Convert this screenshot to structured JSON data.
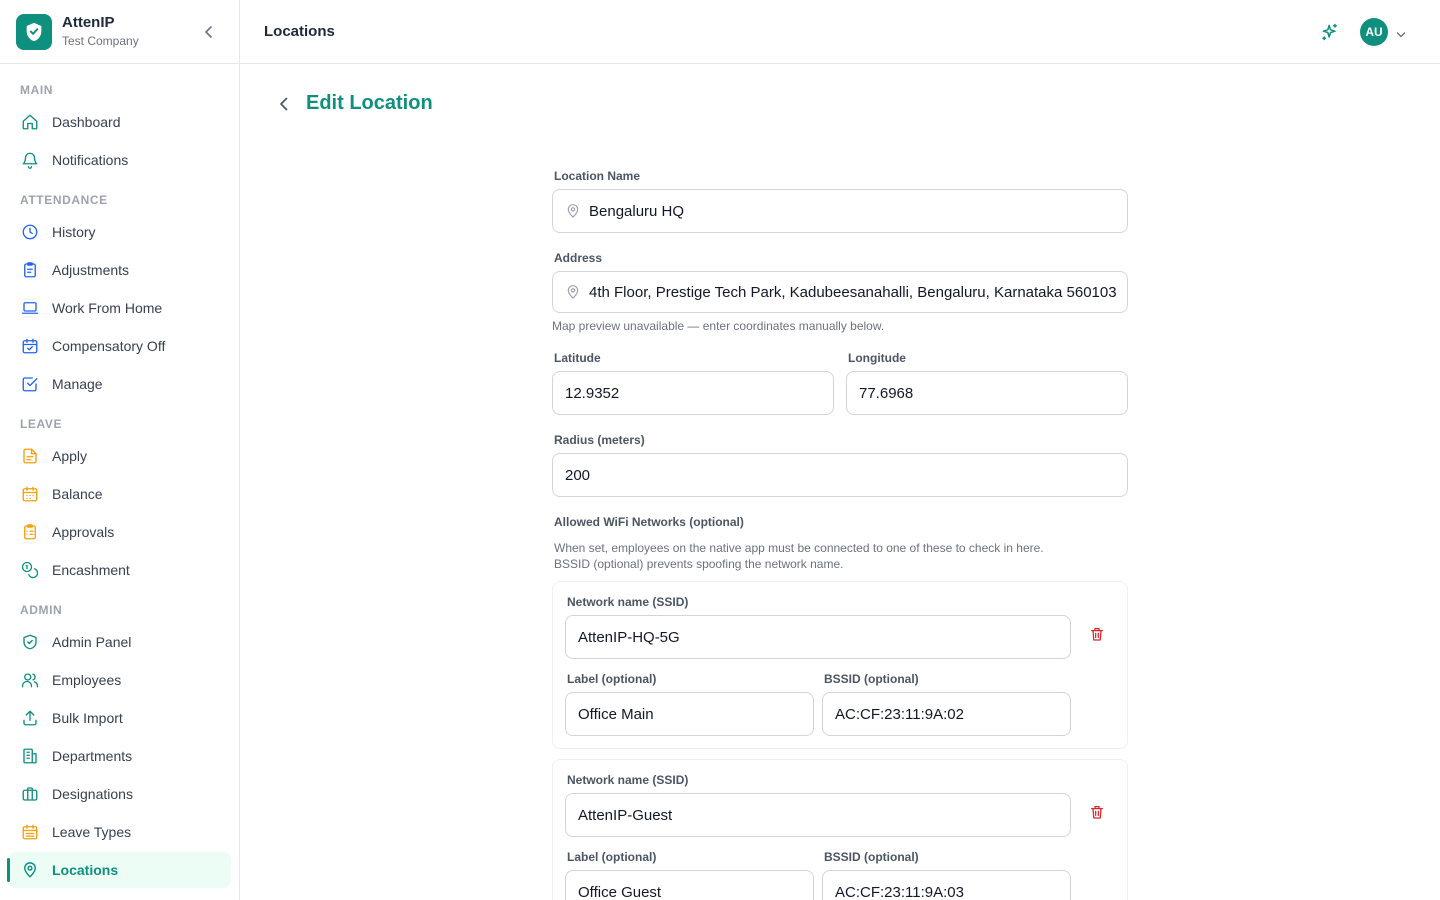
{
  "brand": {
    "name": "AttenIP",
    "company": "Test Company"
  },
  "header": {
    "title": "Locations",
    "avatar_initials": "AU"
  },
  "sidebar": {
    "sections": [
      {
        "label": "MAIN",
        "items": [
          {
            "label": "Dashboard",
            "icon": "home-icon"
          },
          {
            "label": "Notifications",
            "icon": "bell-icon"
          }
        ]
      },
      {
        "label": "ATTENDANCE",
        "items": [
          {
            "label": "History",
            "icon": "clock-icon"
          },
          {
            "label": "Adjustments",
            "icon": "clipboard-icon"
          },
          {
            "label": "Work From Home",
            "icon": "laptop-icon"
          },
          {
            "label": "Compensatory Off",
            "icon": "calendar-check-icon"
          },
          {
            "label": "Manage",
            "icon": "check-square-icon"
          }
        ]
      },
      {
        "label": "LEAVE",
        "items": [
          {
            "label": "Apply",
            "icon": "file-text-icon"
          },
          {
            "label": "Balance",
            "icon": "calendar-icon"
          },
          {
            "label": "Approvals",
            "icon": "clipboard-list-icon"
          },
          {
            "label": "Encashment",
            "icon": "coins-icon"
          }
        ]
      },
      {
        "label": "ADMIN",
        "items": [
          {
            "label": "Admin Panel",
            "icon": "shield-check-icon"
          },
          {
            "label": "Employees",
            "icon": "users-icon"
          },
          {
            "label": "Bulk Import",
            "icon": "upload-icon"
          },
          {
            "label": "Departments",
            "icon": "building-icon"
          },
          {
            "label": "Designations",
            "icon": "briefcase-icon"
          },
          {
            "label": "Leave Types",
            "icon": "calendar-days-icon"
          },
          {
            "label": "Locations",
            "icon": "map-pin-icon",
            "active": true
          }
        ]
      }
    ]
  },
  "page": {
    "title": "Edit Location",
    "form": {
      "location_name_label": "Location Name",
      "location_name": "Bengaluru HQ",
      "address_label": "Address",
      "address": "4th Floor, Prestige Tech Park, Kadubeesanahalli, Bengaluru, Karnataka 560103",
      "map_hint": "Map preview unavailable — enter coordinates manually below.",
      "latitude_label": "Latitude",
      "latitude": "12.9352",
      "longitude_label": "Longitude",
      "longitude": "77.6968",
      "radius_label": "Radius (meters)",
      "radius": "200",
      "wifi_label": "Allowed WiFi Networks (optional)",
      "wifi_help_1": "When set, employees on the native app must be connected to one of these to check in here.",
      "wifi_help_2": "BSSID (optional) prevents spoofing the network name.",
      "ssid_label": "Network name (SSID)",
      "label_label": "Label (optional)",
      "bssid_label": "BSSID (optional)",
      "networks": [
        {
          "ssid": "AttenIP-HQ-5G",
          "label": "Office Main",
          "bssid": "AC:CF:23:11:9A:02"
        },
        {
          "ssid": "AttenIP-Guest",
          "label": "Office Guest",
          "bssid": "AC:CF:23:11:9A:03"
        }
      ]
    }
  },
  "colors": {
    "accent": "#0f8f7e",
    "danger": "#dc2626",
    "active_bg": "#ecfdf5"
  }
}
